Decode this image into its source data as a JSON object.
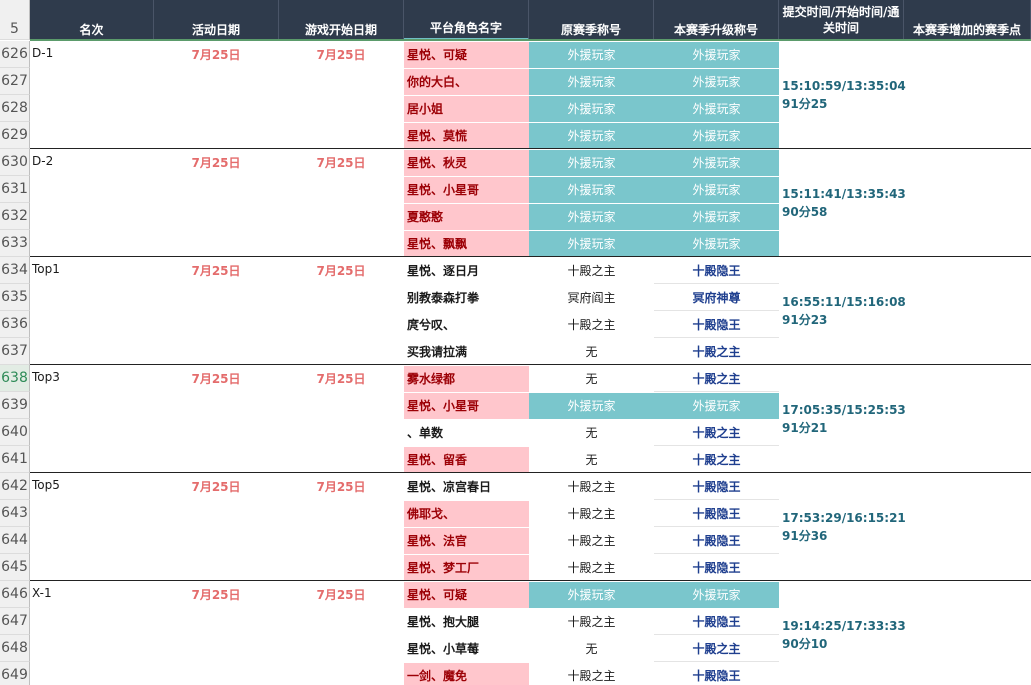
{
  "header": {
    "row_label": "5",
    "columns": [
      "名次",
      "活动日期",
      "游戏开始日期",
      "平台角色名字",
      "原赛季称号",
      "本赛季升级称号",
      "提交时间/开始时间/通关时间",
      "本赛季增加的赛季点"
    ]
  },
  "colors": {
    "header_bg": "#2f3b4c",
    "pink_fill": "#ffc6cc",
    "teal_fill": "#7ac6cc",
    "date_red": "#e46c6c",
    "time_teal": "#21667a",
    "title_blue": "#1f3f8f"
  },
  "groups": [
    {
      "label": "D-1",
      "act_date": "7月25日",
      "start_date": "7月25日",
      "time": "15:10:59/13:35:04",
      "duration": "91分25",
      "rows": [
        {
          "num": "626",
          "name": "星悦、可疑",
          "pink": true,
          "orig": "外援玩家",
          "orig_style": "teal",
          "up": "外援玩家",
          "up_style": "teal"
        },
        {
          "num": "627",
          "name": "你的大白、",
          "pink": true,
          "orig": "外援玩家",
          "orig_style": "teal",
          "up": "外援玩家",
          "up_style": "teal"
        },
        {
          "num": "628",
          "name": "居小姐",
          "pink": true,
          "orig": "外援玩家",
          "orig_style": "teal",
          "up": "外援玩家",
          "up_style": "teal"
        },
        {
          "num": "629",
          "name": "星悦、莫慌",
          "pink": true,
          "orig": "外援玩家",
          "orig_style": "teal",
          "up": "外援玩家",
          "up_style": "teal"
        }
      ]
    },
    {
      "label": "D-2",
      "act_date": "7月25日",
      "start_date": "7月25日",
      "time": "15:11:41/13:35:43",
      "duration": "90分58",
      "rows": [
        {
          "num": "630",
          "name": "星悦、秋灵",
          "pink": true,
          "orig": "外援玩家",
          "orig_style": "teal",
          "up": "外援玩家",
          "up_style": "teal"
        },
        {
          "num": "631",
          "name": "星悦、小星哥",
          "pink": true,
          "orig": "外援玩家",
          "orig_style": "teal",
          "up": "外援玩家",
          "up_style": "teal"
        },
        {
          "num": "632",
          "name": "夏憨憨",
          "pink": true,
          "orig": "外援玩家",
          "orig_style": "teal",
          "up": "外援玩家",
          "up_style": "teal"
        },
        {
          "num": "633",
          "name": "星悦、飘飘",
          "pink": true,
          "orig": "外援玩家",
          "orig_style": "teal",
          "up": "外援玩家",
          "up_style": "teal"
        }
      ]
    },
    {
      "label": "Top1",
      "act_date": "7月25日",
      "start_date": "7月25日",
      "time": "16:55:11/15:16:08",
      "duration": "91分23",
      "rows": [
        {
          "num": "634",
          "name": "星悦、逐日月",
          "pink": false,
          "orig": "十殿之主",
          "orig_style": "plain",
          "up": "十殿隐王",
          "up_style": "blue"
        },
        {
          "num": "635",
          "name": "别教泰森打拳",
          "pink": false,
          "orig": "冥府阎主",
          "orig_style": "plain",
          "up": "冥府神尊",
          "up_style": "blue"
        },
        {
          "num": "636",
          "name": "庹兮叹、",
          "pink": false,
          "orig": "十殿之主",
          "orig_style": "plain",
          "up": "十殿隐王",
          "up_style": "blue"
        },
        {
          "num": "637",
          "name": "买我请拉满",
          "pink": false,
          "orig": "无",
          "orig_style": "plain",
          "up": "十殿之主",
          "up_style": "blue"
        }
      ]
    },
    {
      "label": "Top3",
      "act_date": "7月25日",
      "start_date": "7月25日",
      "time": "17:05:35/15:25:53",
      "duration": "91分21",
      "rows": [
        {
          "num": "638",
          "name": "雾水绿都",
          "pink": true,
          "orig": "无",
          "orig_style": "plain",
          "up": "十殿之主",
          "up_style": "blue",
          "selected": true
        },
        {
          "num": "639",
          "name": "星悦、小星哥",
          "pink": true,
          "orig": "外援玩家",
          "orig_style": "teal",
          "up": "外援玩家",
          "up_style": "teal"
        },
        {
          "num": "640",
          "name": "、单数",
          "pink": false,
          "orig": "无",
          "orig_style": "plain",
          "up": "十殿之主",
          "up_style": "blue"
        },
        {
          "num": "641",
          "name": "星悦、留香",
          "pink": true,
          "orig": "无",
          "orig_style": "plain",
          "up": "十殿之主",
          "up_style": "blue"
        }
      ]
    },
    {
      "label": "Top5",
      "act_date": "7月25日",
      "start_date": "7月25日",
      "time": "17:53:29/16:15:21",
      "duration": "91分36",
      "rows": [
        {
          "num": "642",
          "name": "星悦、凉宫春日",
          "pink": false,
          "orig": "十殿之主",
          "orig_style": "plain",
          "up": "十殿隐王",
          "up_style": "blue"
        },
        {
          "num": "643",
          "name": "佛耶戈、",
          "pink": true,
          "orig": "十殿之主",
          "orig_style": "plain",
          "up": "十殿隐王",
          "up_style": "blue"
        },
        {
          "num": "644",
          "name": "星悦、法官",
          "pink": true,
          "orig": "十殿之主",
          "orig_style": "plain",
          "up": "十殿隐王",
          "up_style": "blue"
        },
        {
          "num": "645",
          "name": "星悦、梦工厂",
          "pink": true,
          "orig": "十殿之主",
          "orig_style": "plain",
          "up": "十殿隐王",
          "up_style": "blue"
        }
      ]
    },
    {
      "label": "X-1",
      "act_date": "7月25日",
      "start_date": "7月25日",
      "time": "19:14:25/17:33:33",
      "duration": "90分10",
      "rows": [
        {
          "num": "646",
          "name": "星悦、可疑",
          "pink": true,
          "orig": "外援玩家",
          "orig_style": "teal",
          "up": "外援玩家",
          "up_style": "teal"
        },
        {
          "num": "647",
          "name": "星悦、抱大腿",
          "pink": false,
          "orig": "十殿之主",
          "orig_style": "plain",
          "up": "十殿隐王",
          "up_style": "blue"
        },
        {
          "num": "648",
          "name": "星悦、小草莓",
          "pink": false,
          "orig": "无",
          "orig_style": "plain",
          "up": "十殿之主",
          "up_style": "blue"
        },
        {
          "num": "649",
          "name": "一剑、魔免",
          "pink": true,
          "orig": "十殿之主",
          "orig_style": "plain",
          "up": "十殿隐王",
          "up_style": "blue"
        }
      ]
    }
  ]
}
